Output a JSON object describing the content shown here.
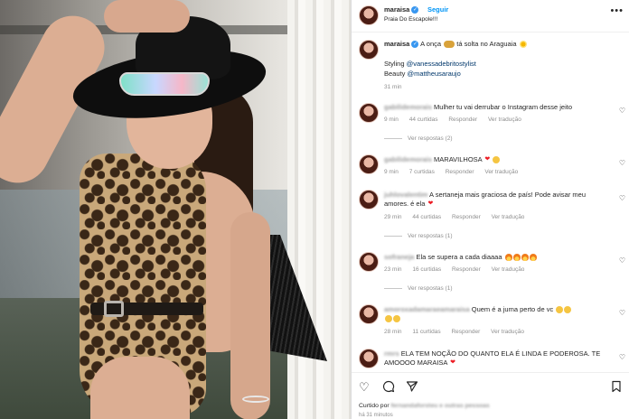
{
  "post": {
    "username": "maraisa",
    "verified_badge": "✓",
    "follow_label": "Seguir",
    "location": "Praia Do Escapole!!!",
    "more_icon": "more-horizontal-icon"
  },
  "caption": {
    "username": "maraisa",
    "text": "A onça",
    "text_cont": "tá solta no Araguaia",
    "styling_prefix": "Styling",
    "styling_handle": "@vanessadebritostylist",
    "beauty_prefix": "Beauty",
    "beauty_handle": "@mattheusaraujo",
    "time": "31 min"
  },
  "comments": [
    {
      "user": "gabilidemorais",
      "text": "Mulher tu vai derrubar o Instagram desse jeito",
      "time": "9 min",
      "likes": "44 curtidas",
      "reply": "Responder",
      "translate": "Ver tradução",
      "replies": "Ver respostas (2)"
    },
    {
      "user": "gabilidemorais",
      "text": "MARAVILHOSA",
      "time": "9 min",
      "likes": "7 curtidas",
      "reply": "Responder",
      "translate": "Ver tradução"
    },
    {
      "user": "juhlovalentim",
      "text": "A sertaneja mais graciosa de país! Pode avisar meu amores. é ela",
      "time": "29 min",
      "likes": "44 curtidas",
      "reply": "Responder",
      "translate": "Ver tradução",
      "replies": "Ver respostas (1)"
    },
    {
      "user": "sofraneja",
      "text": "Ela se supera a cada diaaaa",
      "time": "23 min",
      "likes": "16 curtidas",
      "reply": "Responder",
      "translate": "Ver tradução",
      "replies": "Ver respostas (1)"
    },
    {
      "user": "amoroxadamaraeamaraisa",
      "text": "Quem é a juma perto de vc",
      "time": "28 min",
      "likes": "11 curtidas",
      "reply": "Responder",
      "translate": "Ver tradução"
    },
    {
      "user": "rmrs",
      "text": "ELA TEM NOÇÃO DO QUANTO ELA É LINDA E PODEROSA. TE AMOOOO MARAISA"
    }
  ],
  "actions": {
    "like_icon": "heart-icon",
    "comment_icon": "comment-icon",
    "share_icon": "send-icon",
    "save_icon": "bookmark-icon",
    "liked_by_prefix": "Curtido por",
    "liked_by_user": "fernandaforsteu",
    "liked_by_suffix": "e outras pessoas",
    "time_ago": "há 31 minutos"
  },
  "colors": {
    "link": "#00376b",
    "follow": "#0095f6",
    "verified": "#3897f0",
    "muted": "#8e8e8e"
  }
}
